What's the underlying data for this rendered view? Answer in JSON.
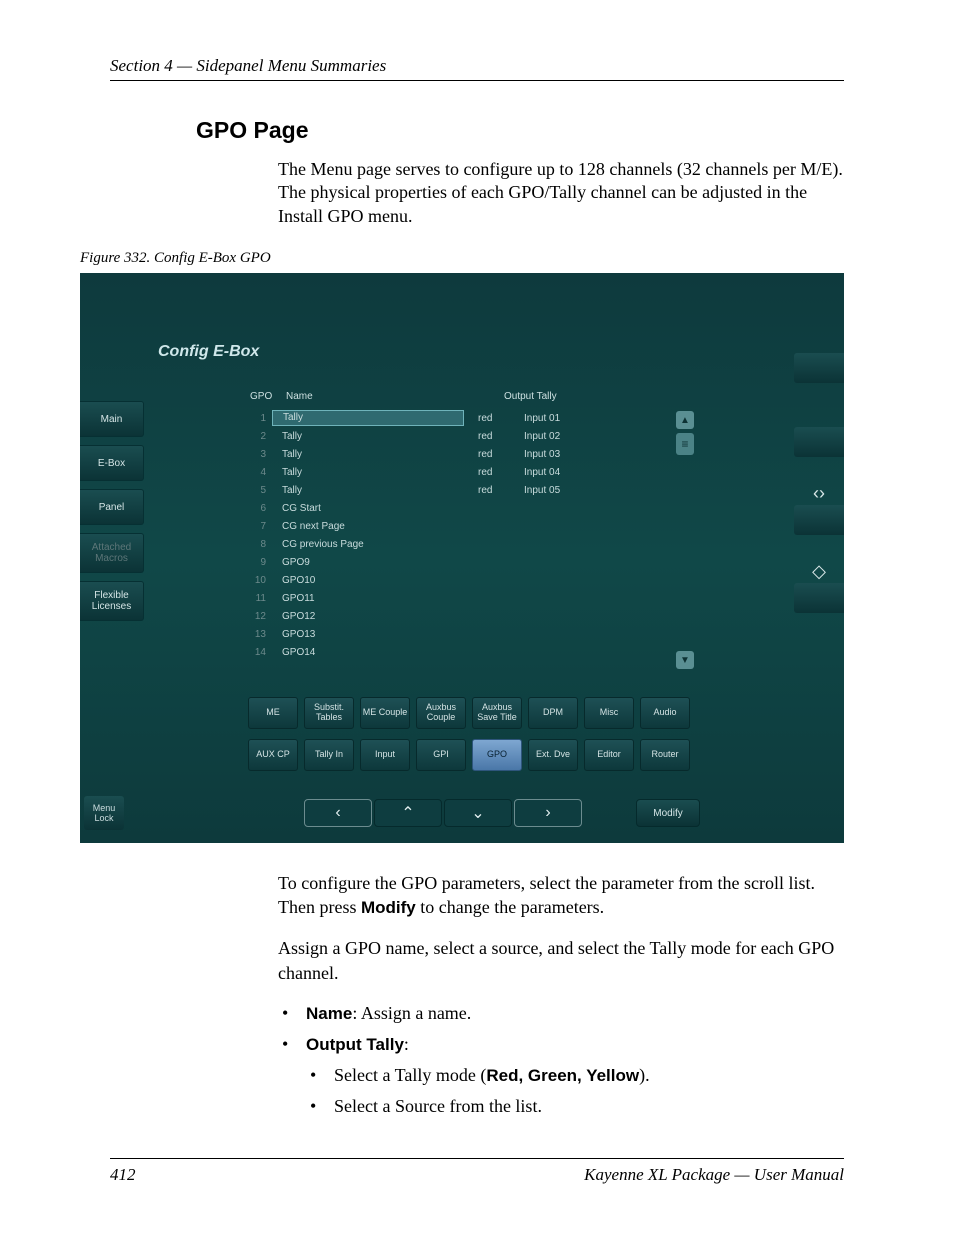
{
  "header": "Section 4 — Sidepanel Menu Summaries",
  "title": "GPO Page",
  "intro": "The Menu page serves to configure up to 128 channels (32 channels per M/E). The physical properties of each GPO/Tally channel can be adjusted in the Install GPO menu.",
  "fig_caption": "Figure 332.  Config E-Box GPO",
  "screenshot": {
    "panel_title": "Config E-Box",
    "left_tabs": [
      {
        "label": "Main",
        "disabled": false
      },
      {
        "label": "E-Box",
        "disabled": false
      },
      {
        "label": "Panel",
        "disabled": false
      },
      {
        "label": "Attached Macros",
        "disabled": true
      },
      {
        "label": "Flexible Licenses",
        "disabled": false
      }
    ],
    "menu_lock": "Menu Lock",
    "col_gpo": "GPO",
    "col_name": "Name",
    "col_out": "Output Tally",
    "rows": [
      {
        "gpo": "1",
        "name": "Tally",
        "tally": "red",
        "src": "Input 01",
        "sel": true
      },
      {
        "gpo": "2",
        "name": "Tally",
        "tally": "red",
        "src": "Input 02"
      },
      {
        "gpo": "3",
        "name": "Tally",
        "tally": "red",
        "src": "Input 03"
      },
      {
        "gpo": "4",
        "name": "Tally",
        "tally": "red",
        "src": "Input 04"
      },
      {
        "gpo": "5",
        "name": "Tally",
        "tally": "red",
        "src": "Input 05"
      },
      {
        "gpo": "6",
        "name": "CG Start",
        "tally": "",
        "src": ""
      },
      {
        "gpo": "7",
        "name": "CG next Page",
        "tally": "",
        "src": ""
      },
      {
        "gpo": "8",
        "name": "CG previous Page",
        "tally": "",
        "src": ""
      },
      {
        "gpo": "9",
        "name": "GPO9",
        "tally": "",
        "src": ""
      },
      {
        "gpo": "10",
        "name": "GPO10",
        "tally": "",
        "src": ""
      },
      {
        "gpo": "11",
        "name": "GPO11",
        "tally": "",
        "src": ""
      },
      {
        "gpo": "12",
        "name": "GPO12",
        "tally": "",
        "src": ""
      },
      {
        "gpo": "13",
        "name": "GPO13",
        "tally": "",
        "src": ""
      },
      {
        "gpo": "14",
        "name": "GPO14",
        "tally": "",
        "src": ""
      }
    ],
    "btn_row1": [
      "ME",
      "Substit. Tables",
      "ME Couple",
      "Auxbus Couple",
      "Auxbus Save Title",
      "DPM",
      "Misc",
      "Audio"
    ],
    "btn_row2": [
      "AUX CP",
      "Tally In",
      "Input",
      "GPI",
      "GPO",
      "Ext. Dve",
      "Editor",
      "Router"
    ],
    "active_btn": "GPO",
    "modify": "Modify"
  },
  "post": {
    "p1a": "To configure the GPO parameters, select the parameter from the scroll list. Then press ",
    "p1b": "Modify",
    "p1c": " to change the parameters.",
    "p2": "Assign a GPO name, select a source, and select the Tally mode for each GPO channel.",
    "b1_bold": "Name",
    "b1_rest": ": Assign a name.",
    "b2_bold": "Output Tally",
    "b2_rest": ":",
    "sb1a": "Select a Tally mode (",
    "sb1b": "Red, Green, Yellow",
    "sb1c": ").",
    "sb2": "Select a Source from the list."
  },
  "footer": {
    "page": "412",
    "doc": "Kayenne XL Package — User Manual"
  }
}
